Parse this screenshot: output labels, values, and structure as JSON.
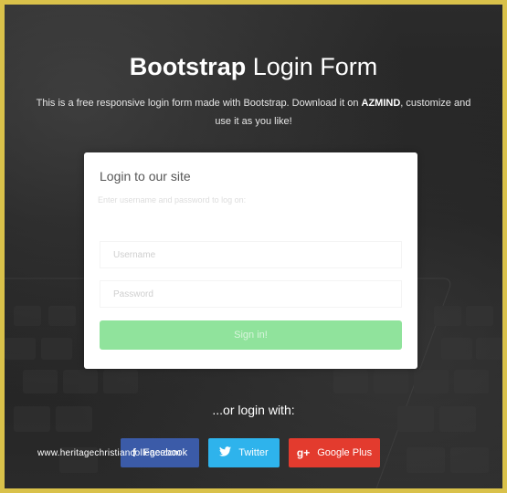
{
  "header": {
    "title_bold": "Bootstrap",
    "title_rest": "Login Form",
    "subtitle_pre": "This is a free responsive login form made with Bootstrap. Download it on",
    "subtitle_brand": "AZMIND",
    "subtitle_post": ", customize and use it as you like!"
  },
  "form": {
    "title": "Login to our site",
    "subtitle": "Enter username and password to log on:",
    "username_placeholder": "Username",
    "password_placeholder": "Password",
    "signin_label": "Sign in!"
  },
  "social": {
    "or_label": "...or login with:",
    "facebook_label": "Facebook",
    "twitter_label": "Twitter",
    "google_label": "Google Plus"
  },
  "watermark": "www.heritagechristiancollege.com",
  "colors": {
    "frame": "#d9c14a",
    "signin": "#90e39c",
    "facebook": "#3b5ba8",
    "twitter": "#2eb3ec",
    "google": "#e33b2e"
  }
}
